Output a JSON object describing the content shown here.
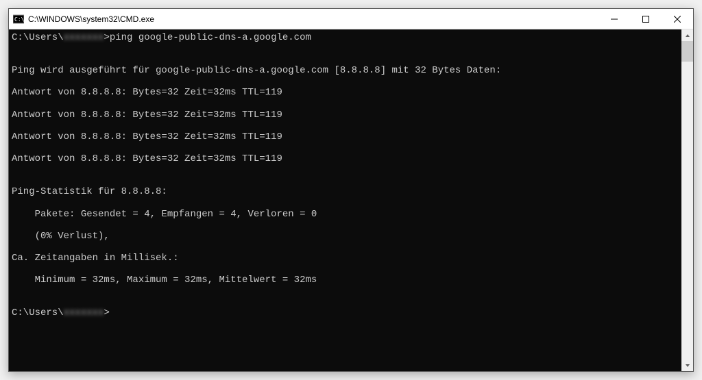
{
  "window": {
    "title": "C:\\WINDOWS\\system32\\CMD.exe"
  },
  "terminal": {
    "prompt1_prefix": "C:\\Users\\",
    "prompt1_redacted": "xxxxxxx",
    "prompt1_command": ">ping google-public-dns-a.google.com",
    "blank1": "",
    "ping_header": "Ping wird ausgeführt für google-public-dns-a.google.com [8.8.8.8] mit 32 Bytes Daten:",
    "reply1": "Antwort von 8.8.8.8: Bytes=32 Zeit=32ms TTL=119",
    "reply2": "Antwort von 8.8.8.8: Bytes=32 Zeit=32ms TTL=119",
    "reply3": "Antwort von 8.8.8.8: Bytes=32 Zeit=32ms TTL=119",
    "reply4": "Antwort von 8.8.8.8: Bytes=32 Zeit=32ms TTL=119",
    "blank2": "",
    "stats_header": "Ping-Statistik für 8.8.8.8:",
    "stats_packets": "    Pakete: Gesendet = 4, Empfangen = 4, Verloren = 0",
    "stats_loss": "    (0% Verlust),",
    "stats_timing_header": "Ca. Zeitangaben in Millisek.:",
    "stats_timing": "    Minimum = 32ms, Maximum = 32ms, Mittelwert = 32ms",
    "blank3": "",
    "prompt2_prefix": "C:\\Users\\",
    "prompt2_redacted": "xxxxxxx",
    "prompt2_suffix": ">"
  }
}
